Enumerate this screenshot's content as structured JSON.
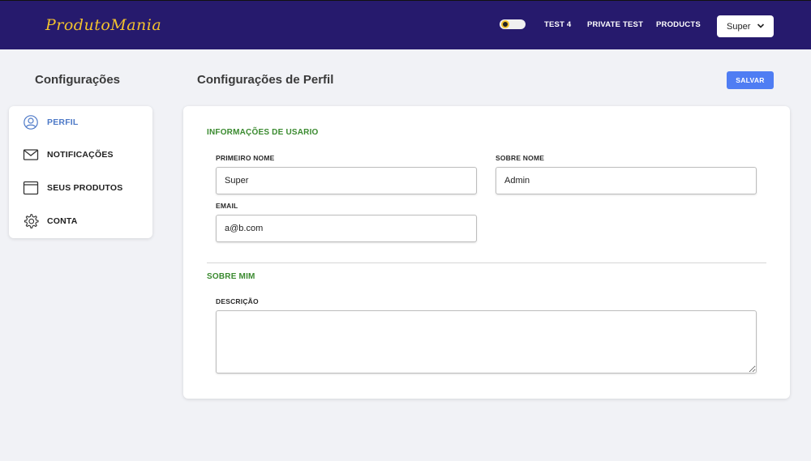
{
  "header": {
    "logo": "ProdutoMania",
    "nav": [
      "TEST 4",
      "PRIVATE TEST",
      "PRODUCTS"
    ],
    "user_select": "Super"
  },
  "sidebar": {
    "title": "Configurações",
    "items": [
      {
        "label": "PERFIL",
        "icon": "user-circle-icon",
        "active": true
      },
      {
        "label": "NOTIFICAÇÕES",
        "icon": "envelope-icon",
        "active": false
      },
      {
        "label": "SEUS PRODUTOS",
        "icon": "browser-window-icon",
        "active": false
      },
      {
        "label": "CONTA",
        "icon": "gear-icon",
        "active": false
      }
    ]
  },
  "main": {
    "title": "Configurações de Perfil",
    "save_label": "SALVAR",
    "user_info": {
      "section_title": "INFORMAÇÕES DE USARIO",
      "first_name_label": "PRIMEIRO NOME",
      "first_name_value": "Super",
      "last_name_label": "SOBRE NOME",
      "last_name_value": "Admin",
      "email_label": "EMAIL",
      "email_value": "a@b.com"
    },
    "about": {
      "section_title": "SOBRE MIM",
      "description_label": "DESCRIÇÃO",
      "description_value": ""
    }
  },
  "colors": {
    "header_bg": "#261a6d",
    "logo": "#f2c12e",
    "accent": "#4f7df3",
    "section_title": "#3a8a2f",
    "active_item": "#4d79c7"
  }
}
